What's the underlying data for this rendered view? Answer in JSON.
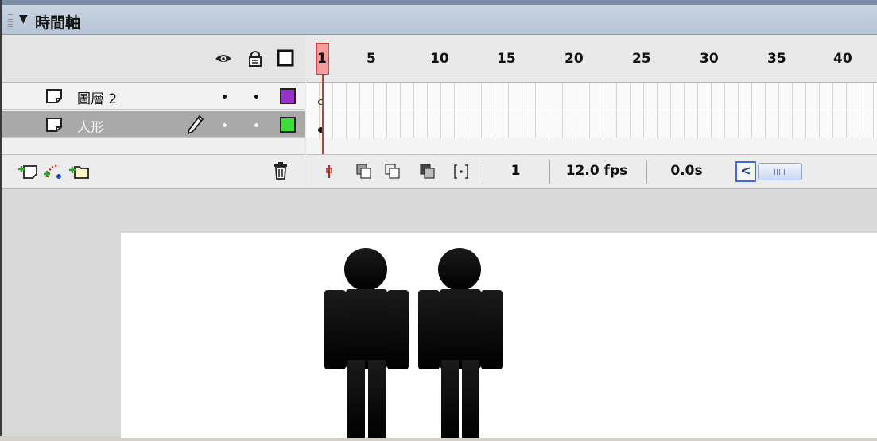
{
  "panel": {
    "title": "時間軸",
    "collapse_glyph": "▼"
  },
  "layers": [
    {
      "name": "圖層 2",
      "color": "#9b30c8",
      "selected": false
    },
    {
      "name": "人形",
      "color": "#3adf3a",
      "selected": true
    }
  ],
  "ruler": {
    "labels": [
      "1",
      "5",
      "10",
      "15",
      "20",
      "25",
      "30",
      "35",
      "40"
    ]
  },
  "status": {
    "current_frame": "1",
    "frame_rate": "12.0 fps",
    "elapsed_time": "0.0s"
  },
  "icons": {
    "header": [
      "eye-icon",
      "lock-icon",
      "outline-icon"
    ],
    "layer_footer": [
      "add-layer-icon",
      "add-motion-guide-icon",
      "add-folder-icon",
      "trash-icon"
    ],
    "frame_footer": [
      "center-frame-icon",
      "onion-skin-icon",
      "onion-skin-outlines-icon",
      "edit-multiple-frames-icon",
      "modify-onion-markers-icon"
    ]
  },
  "stage": {
    "figure_count": 2,
    "figure_color": "#111111",
    "background": "#ffffff"
  }
}
